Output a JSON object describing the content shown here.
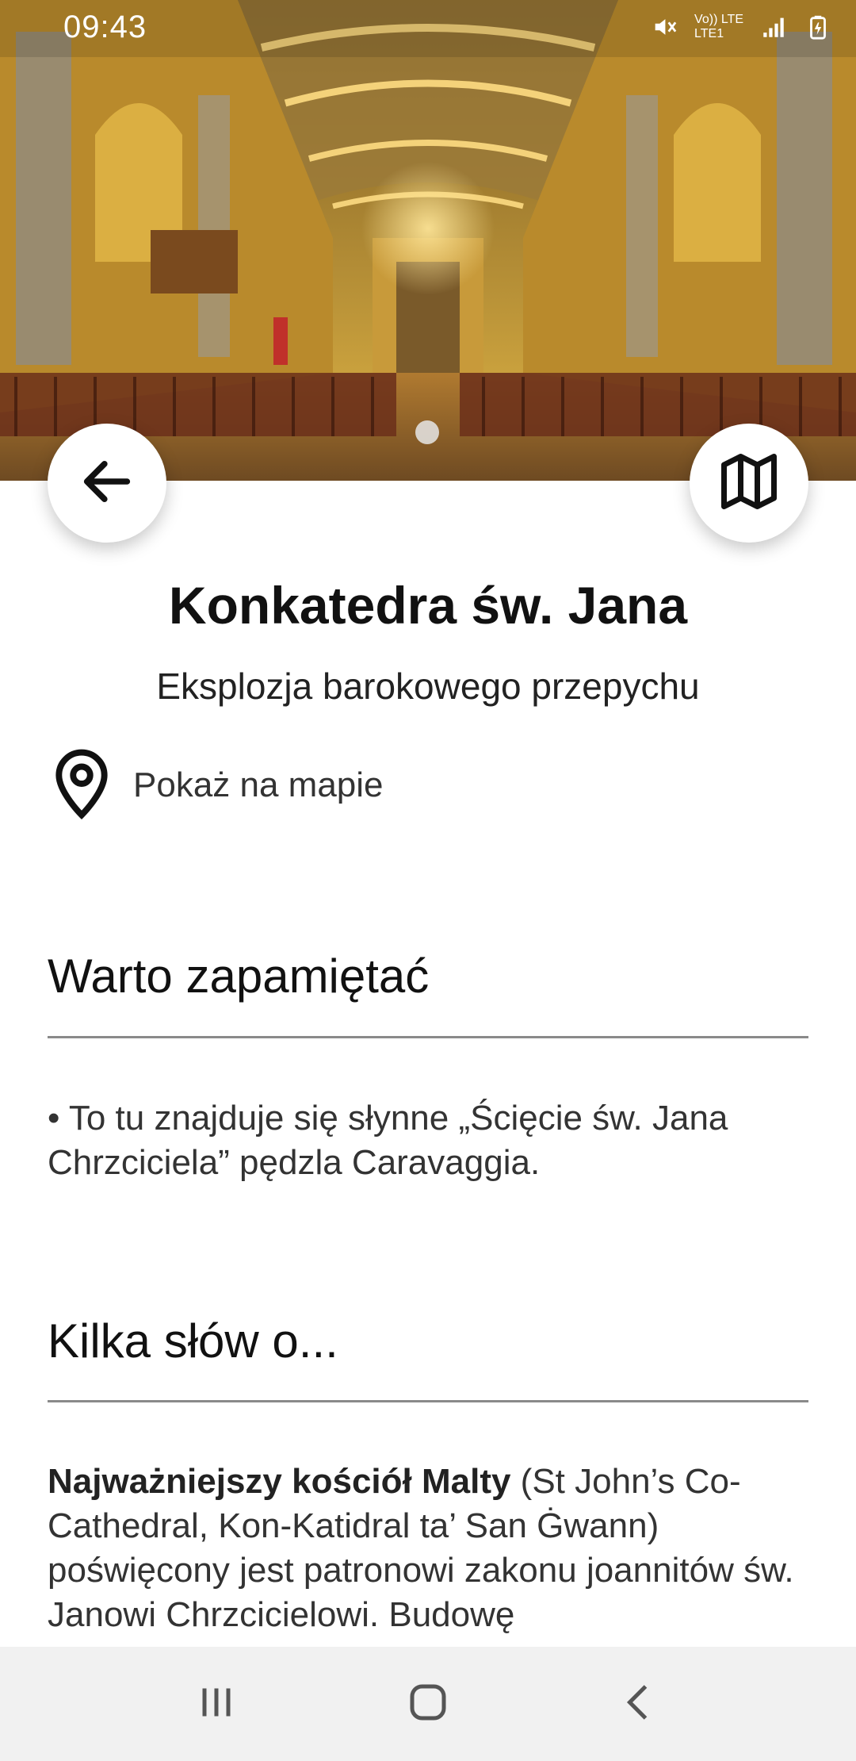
{
  "status_bar": {
    "time": "09:43",
    "icons": [
      "mute-icon",
      "volte-icon",
      "lte-icon",
      "signal-icon",
      "battery-icon"
    ],
    "network_label_top": "Vo)) LTE",
    "network_label_bottom": "LTE1"
  },
  "hero": {
    "image": "cathedral-interior-photo",
    "page_indicator": {
      "count": 1,
      "active": 0
    }
  },
  "header": {
    "title": "Konkatedra św. Jana",
    "subtitle": "Eksplozja barokowego przepychu",
    "show_on_map": "Pokaż na mapie"
  },
  "sections": [
    {
      "heading": "Warto zapamiętać",
      "body": "• To tu znajduje się słynne „Ścięcie św. Jana Chrzciciela” pędzla Caravaggia."
    },
    {
      "heading": "Kilka słów o...",
      "body_bold": "Najważniejszy kościół Malty",
      "body": " (St John’s Co-Cathedral, Kon-Katidral ta’ San Ġwann) poświęcony jest patronowi zakonu joannitów św. Janowi Chrzcicielowi. Budowę"
    }
  ],
  "nav_bar": {
    "buttons": [
      "recent-apps",
      "home",
      "back"
    ]
  },
  "colors": {
    "accent_gold": "#d9aa3a",
    "text_dark": "#111111",
    "rule": "#8a8a8a",
    "nav_background": "#f1f1f1"
  }
}
